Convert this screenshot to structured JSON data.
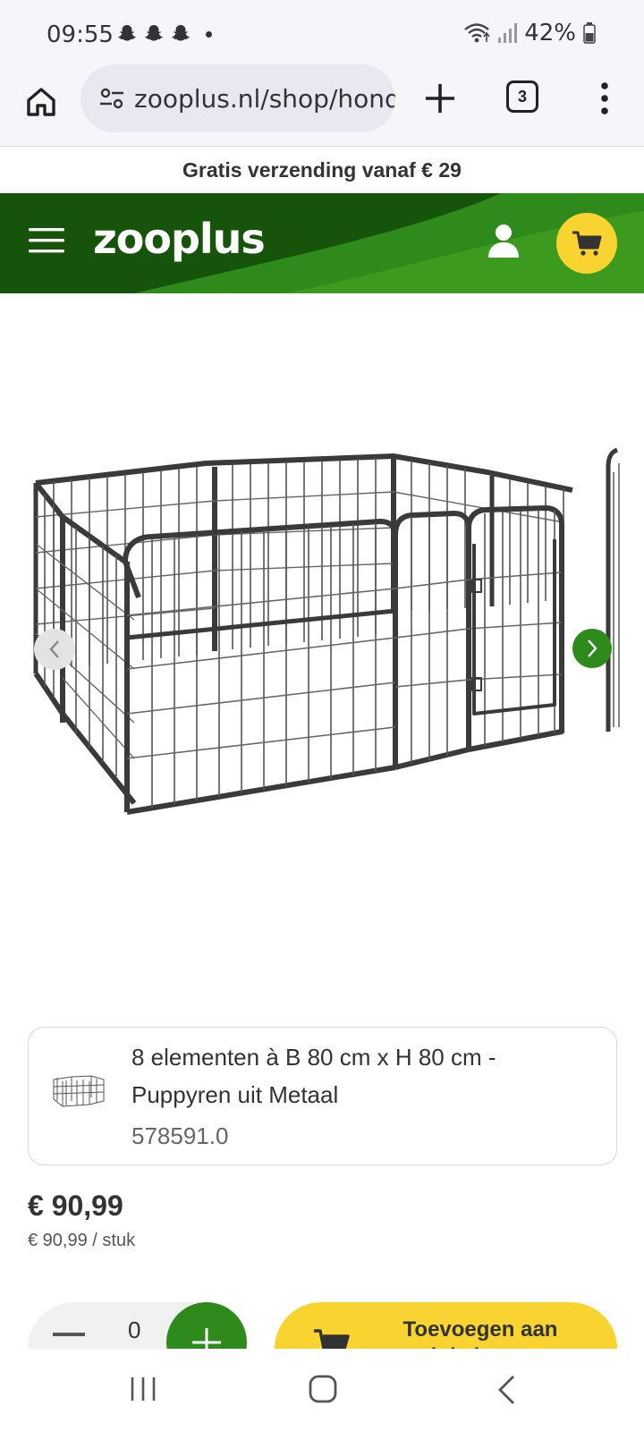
{
  "status_bar": {
    "time": "09:55",
    "battery": "42%",
    "notification_icons": [
      "snapchat-icon",
      "snapchat-icon",
      "snapchat-icon"
    ]
  },
  "browser": {
    "url": "zooplus.nl/shop/honden",
    "tab_count": "3"
  },
  "promo": {
    "text": "Gratis verzending vanaf € 29"
  },
  "header": {
    "logo": "zooplus",
    "colors": {
      "header_dark": "#15540a",
      "header_light": "#3c9a1f",
      "cart_yellow": "#f9d430"
    }
  },
  "product": {
    "variant_name": "8 elementen à B 80 cm x H 80 cm - Puppyren uit Metaal",
    "sku": "578591.0",
    "price": "€ 90,99",
    "unit_price": "€ 90,99 / stuk",
    "quantity": "0",
    "add_to_cart_label": "Toevoegen aan winkelwagen"
  },
  "colors": {
    "accent_green": "#2e8b1b"
  }
}
